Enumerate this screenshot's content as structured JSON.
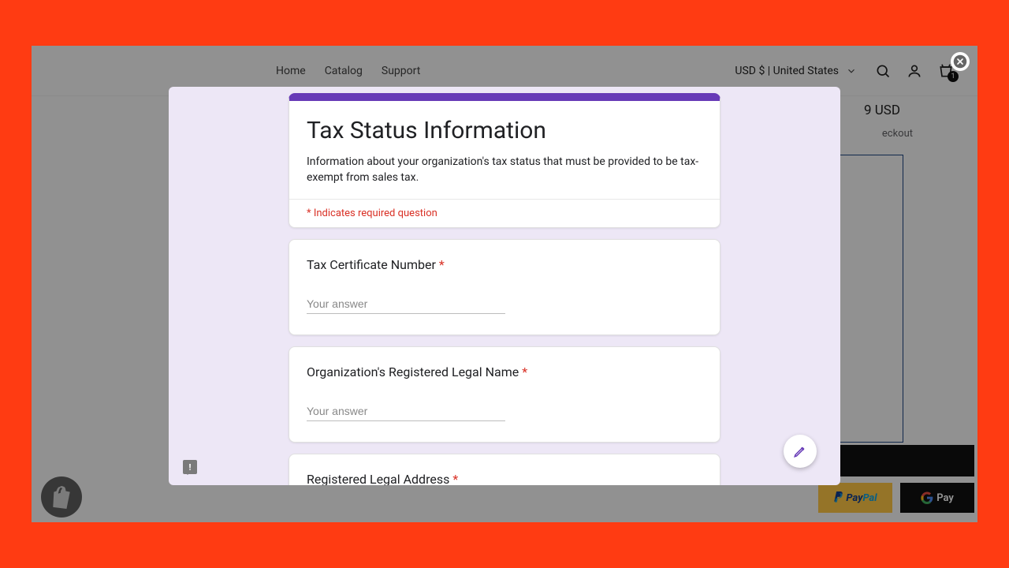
{
  "nav": {
    "home": "Home",
    "catalog": "Catalog",
    "support": "Support"
  },
  "header": {
    "currency_label": "USD $ | United States",
    "cart_badge": "1"
  },
  "bg": {
    "price_suffix": "9 USD",
    "shipping_suffix": "eckout",
    "paypal_pay": "Pay",
    "paypal_pal": "Pal",
    "gpay": "Pay"
  },
  "form": {
    "title": "Tax Status Information",
    "description": "Information about your organization's tax status that must be provided to be tax-exempt from sales tax.",
    "required_note": "* Indicates required question",
    "placeholder": "Your answer",
    "q1": "Tax Certificate Number",
    "q2": "Organization's Registered Legal Name",
    "q3": "Registered Legal Address"
  }
}
